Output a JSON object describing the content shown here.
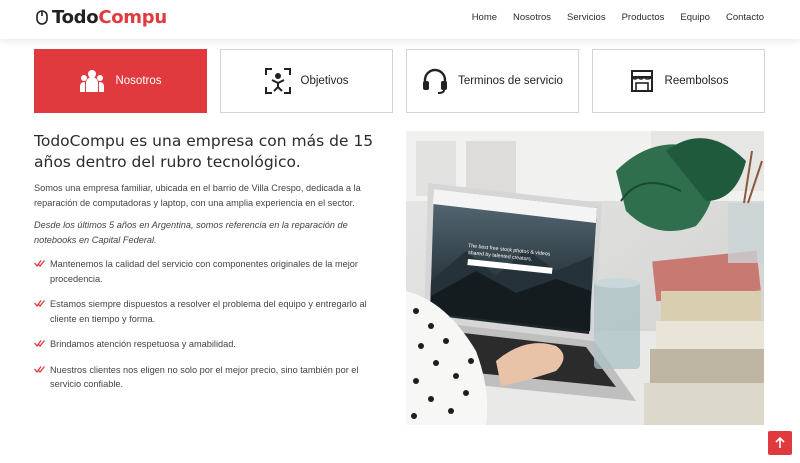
{
  "brand": {
    "part1": "Todo",
    "part2": "Compu"
  },
  "nav": [
    "Home",
    "Nosotros",
    "Servicios",
    "Productos",
    "Equipo",
    "Contacto"
  ],
  "tabs": [
    {
      "label": "Nosotros",
      "icon": "team-icon",
      "active": true
    },
    {
      "label": "Objetivos",
      "icon": "target-person-icon",
      "active": false
    },
    {
      "label": "Terminos de servicio",
      "icon": "headset-icon",
      "active": false
    },
    {
      "label": "Reembolsos",
      "icon": "store-icon",
      "active": false
    }
  ],
  "about": {
    "heading": "TodoCompu es una empresa con más de 15 años dentro del rubro tecnológico.",
    "paragraph": "Somos una empresa familiar, ubicada en el barrio de Villa Crespo, dedicada a la reparación de computadoras y laptop, con una amplia experiencia en el sector.",
    "italic": "Desde los últimos 5 años en Argentina, somos referencia en la reparación de notebooks en Capital Federal.",
    "points": [
      "Mantenemos la calidad del servicio con componentes originales de la mejor procedencia.",
      "Estamos siempre dispuestos a resolver el problema del equipo y entregarlo al cliente en tiempo y forma.",
      "Brindamos atención respetuosa y amabilidad.",
      "Nuestros clientes nos eligen no solo por el mejor precio, sino también por el servicio confiable."
    ]
  },
  "photo": {
    "screen_line1": "The best free stock photos & videos",
    "screen_line2": "shared by talented creators."
  },
  "colors": {
    "accent": "#e03a3e",
    "text": "#2b2b2b"
  }
}
